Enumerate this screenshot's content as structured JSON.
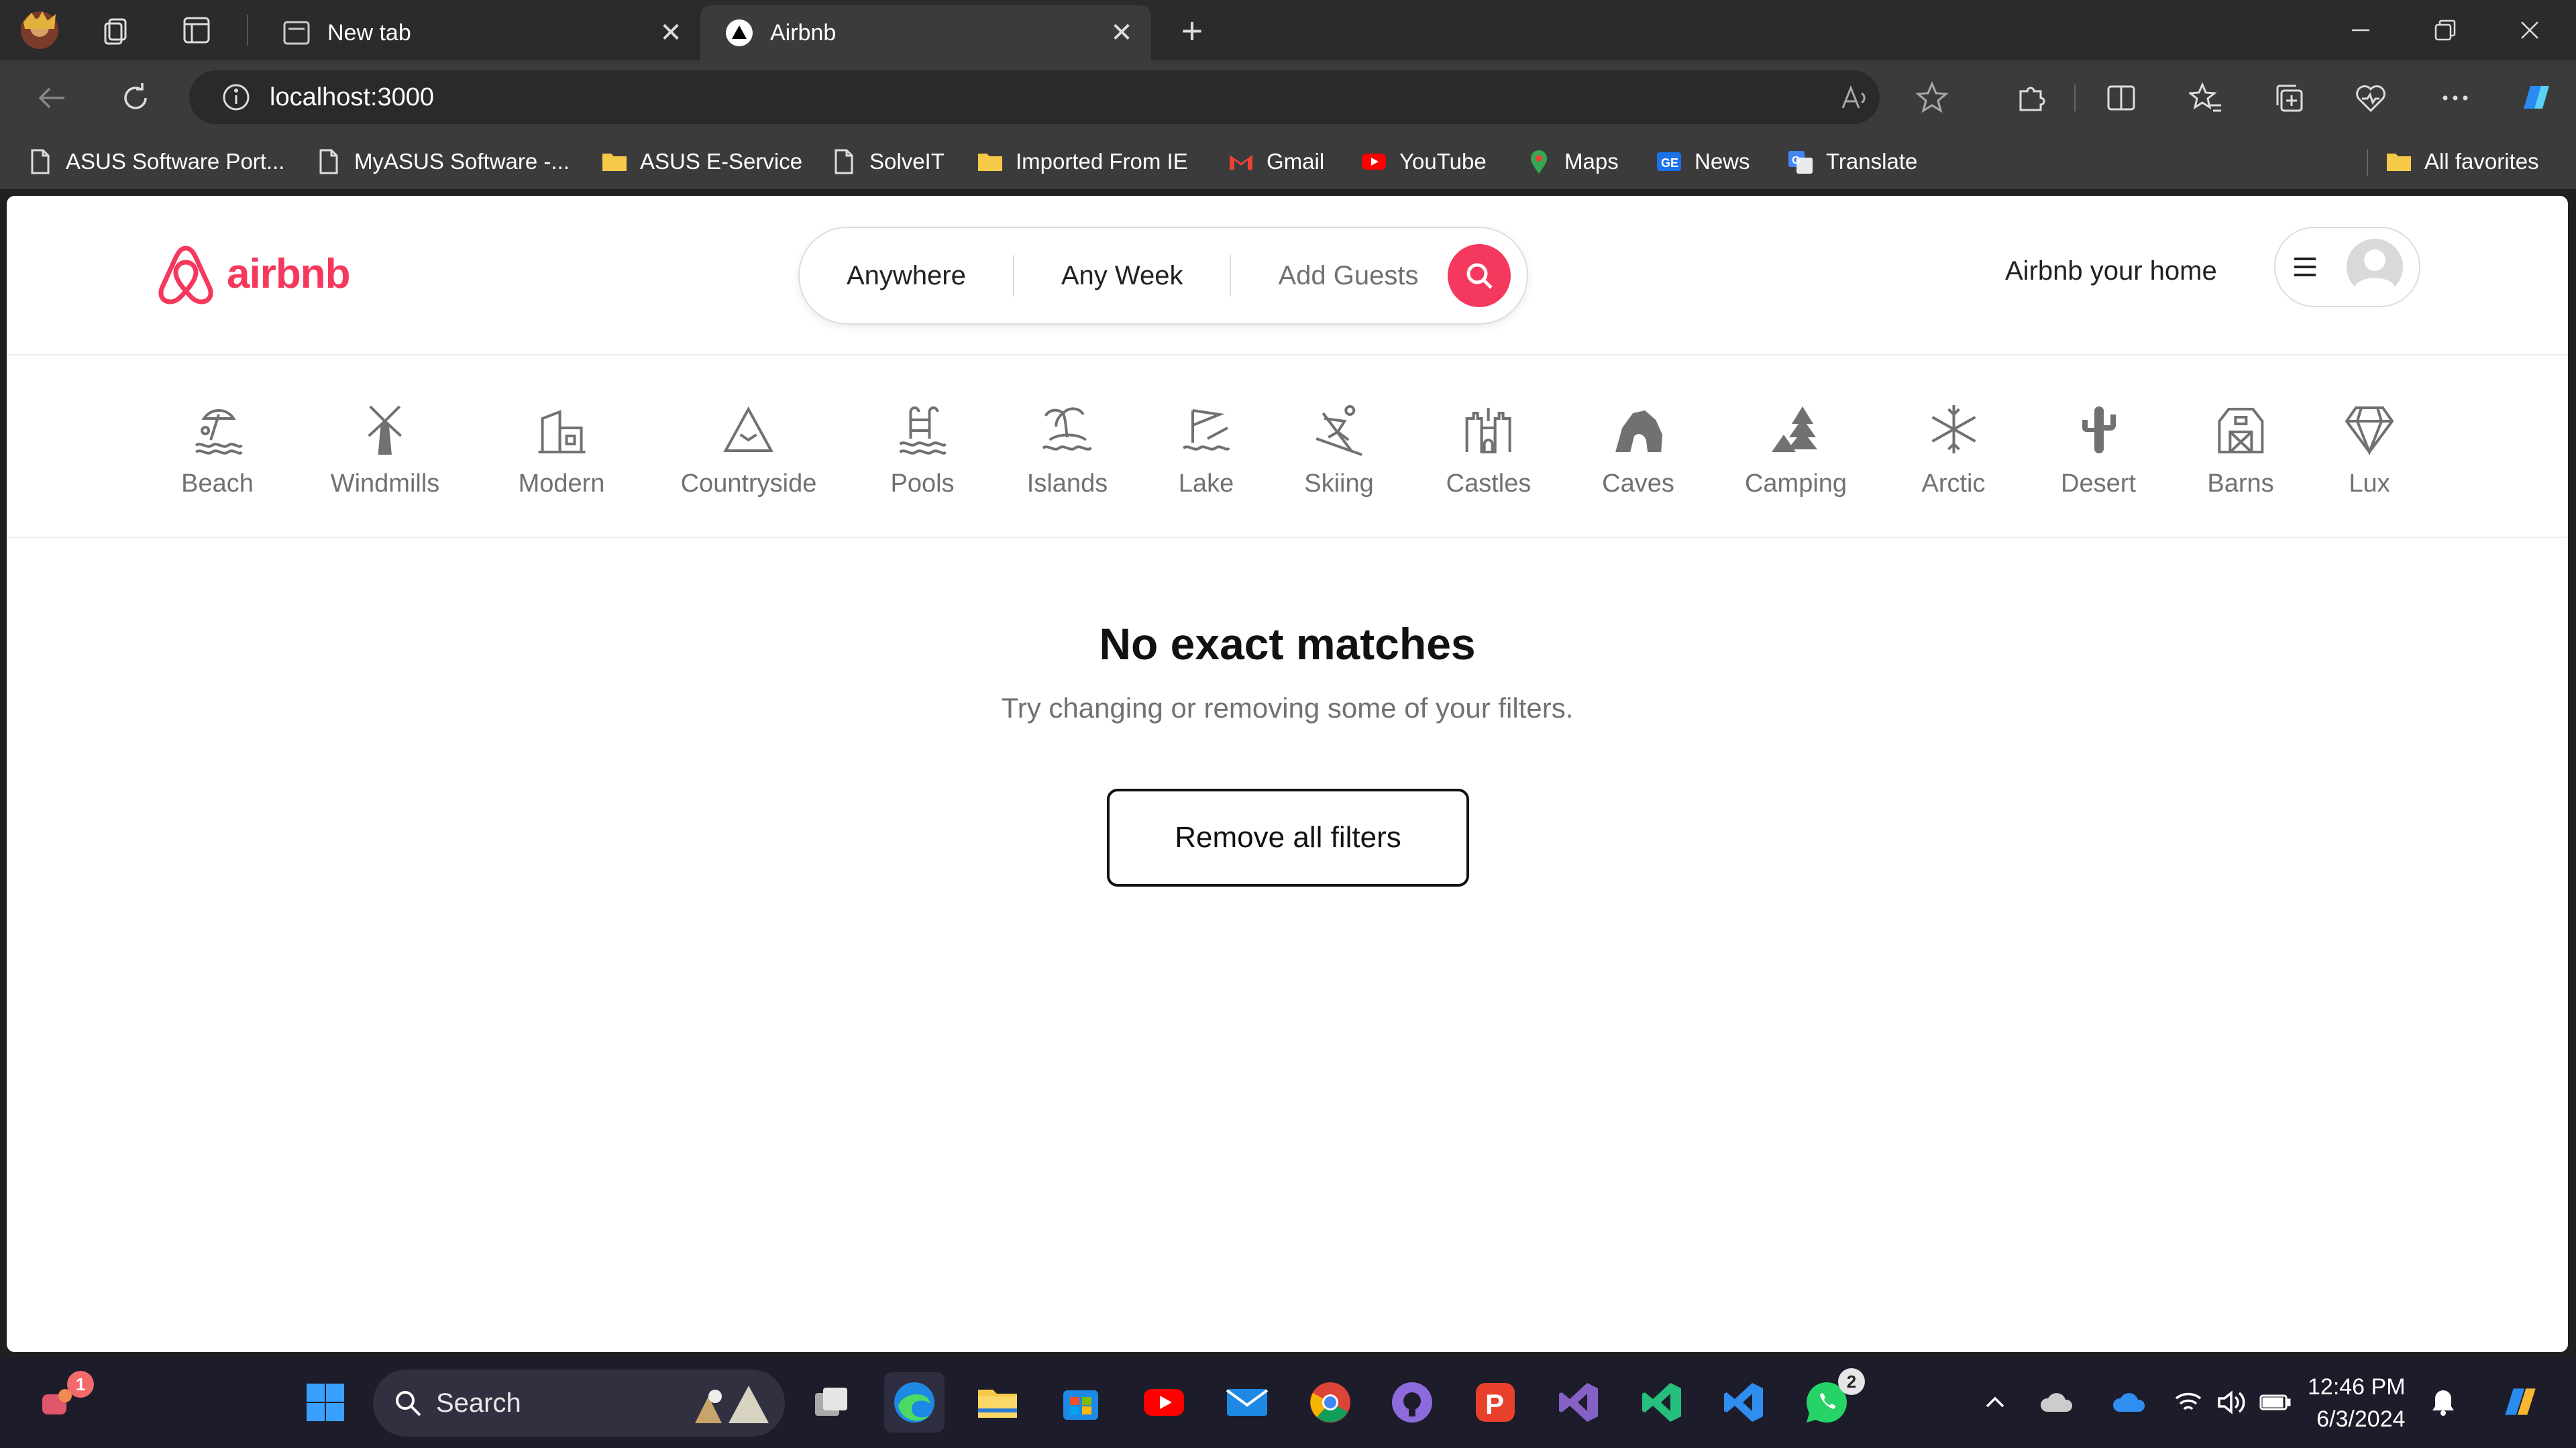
{
  "browser": {
    "tabs": [
      {
        "title": "New tab",
        "close": "✕"
      },
      {
        "title": "Airbnb",
        "close": "✕"
      }
    ],
    "new_tab_symbol": "+",
    "url": "localhost:3000",
    "bookmarks": [
      {
        "label": "ASUS Software Port...",
        "icon": "page-icon"
      },
      {
        "label": "MyASUS Software -...",
        "icon": "page-icon"
      },
      {
        "label": "ASUS E-Service",
        "icon": "folder-icon"
      },
      {
        "label": "SolveIT",
        "icon": "page-icon"
      },
      {
        "label": "Imported From IE",
        "icon": "folder-icon"
      },
      {
        "label": "Gmail",
        "icon": "gmail-icon"
      },
      {
        "label": "YouTube",
        "icon": "youtube-icon"
      },
      {
        "label": "Maps",
        "icon": "maps-icon"
      },
      {
        "label": "News",
        "icon": "news-icon"
      },
      {
        "label": "Translate",
        "icon": "translate-icon"
      }
    ],
    "all_favorites": "All favorites"
  },
  "airbnb": {
    "brand": "airbnb",
    "brand_color": "#F5385D",
    "search": {
      "where": "Anywhere",
      "when": "Any Week",
      "guests": "Add Guests"
    },
    "host_link": "Airbnb your home",
    "categories": [
      {
        "label": "Beach",
        "icon": "beach-icon"
      },
      {
        "label": "Windmills",
        "icon": "windmill-icon"
      },
      {
        "label": "Modern",
        "icon": "modern-icon"
      },
      {
        "label": "Countryside",
        "icon": "mountain-icon"
      },
      {
        "label": "Pools",
        "icon": "pool-icon"
      },
      {
        "label": "Islands",
        "icon": "island-icon"
      },
      {
        "label": "Lake",
        "icon": "lake-icon"
      },
      {
        "label": "Skiing",
        "icon": "skiing-icon"
      },
      {
        "label": "Castles",
        "icon": "castle-icon"
      },
      {
        "label": "Caves",
        "icon": "cave-icon"
      },
      {
        "label": "Camping",
        "icon": "camping-icon"
      },
      {
        "label": "Arctic",
        "icon": "snowflake-icon"
      },
      {
        "label": "Desert",
        "icon": "cactus-icon"
      },
      {
        "label": "Barns",
        "icon": "barn-icon"
      },
      {
        "label": "Lux",
        "icon": "diamond-icon"
      }
    ],
    "empty_state": {
      "title": "No exact matches",
      "subtitle": "Try changing or removing some of your filters.",
      "button": "Remove all filters"
    }
  },
  "taskbar": {
    "search_label": "Search",
    "time": "12:46 PM",
    "date": "6/3/2024",
    "notification_badge": "1",
    "whatsapp_badge": "2"
  }
}
